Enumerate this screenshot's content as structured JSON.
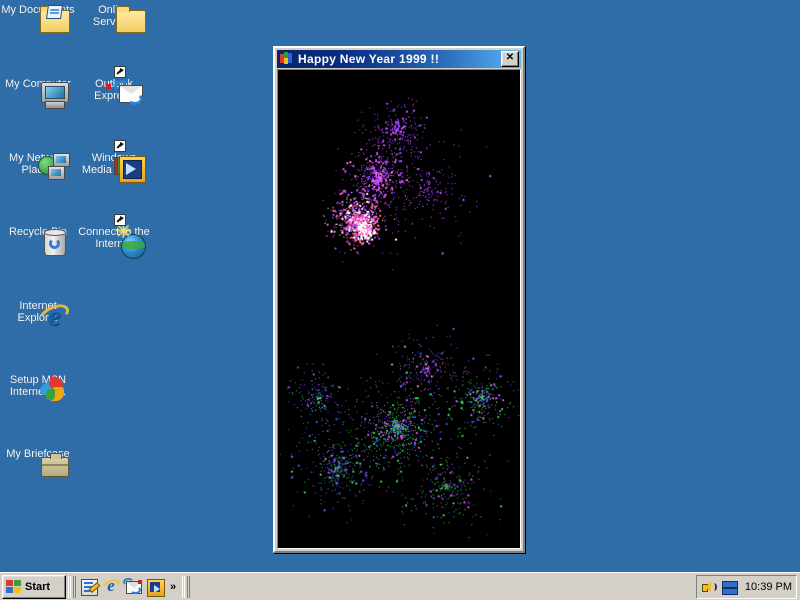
{
  "desktop": {
    "background_color": "#2e6da8",
    "icons": [
      {
        "name": "my-documents",
        "label": "My Documents",
        "column": 0,
        "row": 0
      },
      {
        "name": "my-computer",
        "label": "My Computer",
        "column": 0,
        "row": 1
      },
      {
        "name": "my-network-places",
        "label": "My Network\nPlaces",
        "column": 0,
        "row": 2
      },
      {
        "name": "recycle-bin",
        "label": "Recycle Bin",
        "column": 0,
        "row": 3
      },
      {
        "name": "internet-explorer",
        "label": "Internet\nExplorer",
        "column": 0,
        "row": 4
      },
      {
        "name": "setup-msn",
        "label": "Setup MSN\nInternet A...",
        "column": 0,
        "row": 5
      },
      {
        "name": "my-briefcase",
        "label": "My Briefcase",
        "column": 0,
        "row": 6
      },
      {
        "name": "online-services",
        "label": "Online\nServices",
        "column": 1,
        "row": 0
      },
      {
        "name": "outlook-express",
        "label": "Outlook\nExpress",
        "column": 1,
        "row": 1
      },
      {
        "name": "windows-media-player",
        "label": "Windows\nMedia Player",
        "column": 1,
        "row": 2
      },
      {
        "name": "connect-to-internet",
        "label": "Connect to the\nInternet",
        "column": 1,
        "row": 3
      }
    ]
  },
  "window": {
    "title": "Happy New Year 1999 !!",
    "close_label": "✕",
    "titlebar_color_start": "#08246b",
    "titlebar_color_end": "#64b6ef",
    "canvas_background": "#000000",
    "particle_colors": [
      "#ff66cc",
      "#cc44ff",
      "#ff5577",
      "#ffffff",
      "#33cc44",
      "#3355dd",
      "#8844ff"
    ]
  },
  "taskbar": {
    "start_label": "Start",
    "quicklaunch": [
      {
        "name": "show-desktop",
        "title": "Show Desktop"
      },
      {
        "name": "launch-internet-explorer",
        "title": "Launch Internet Explorer Browser"
      },
      {
        "name": "launch-outlook-express",
        "title": "Launch Outlook Express"
      },
      {
        "name": "windows-media-player",
        "title": "Windows Media Player"
      }
    ],
    "overflow_label": "»",
    "tray": {
      "icons": [
        {
          "name": "volume-icon",
          "title": "Volume"
        },
        {
          "name": "task-scheduler-icon",
          "title": "Task Scheduler"
        }
      ],
      "clock": "10:39 PM"
    }
  }
}
